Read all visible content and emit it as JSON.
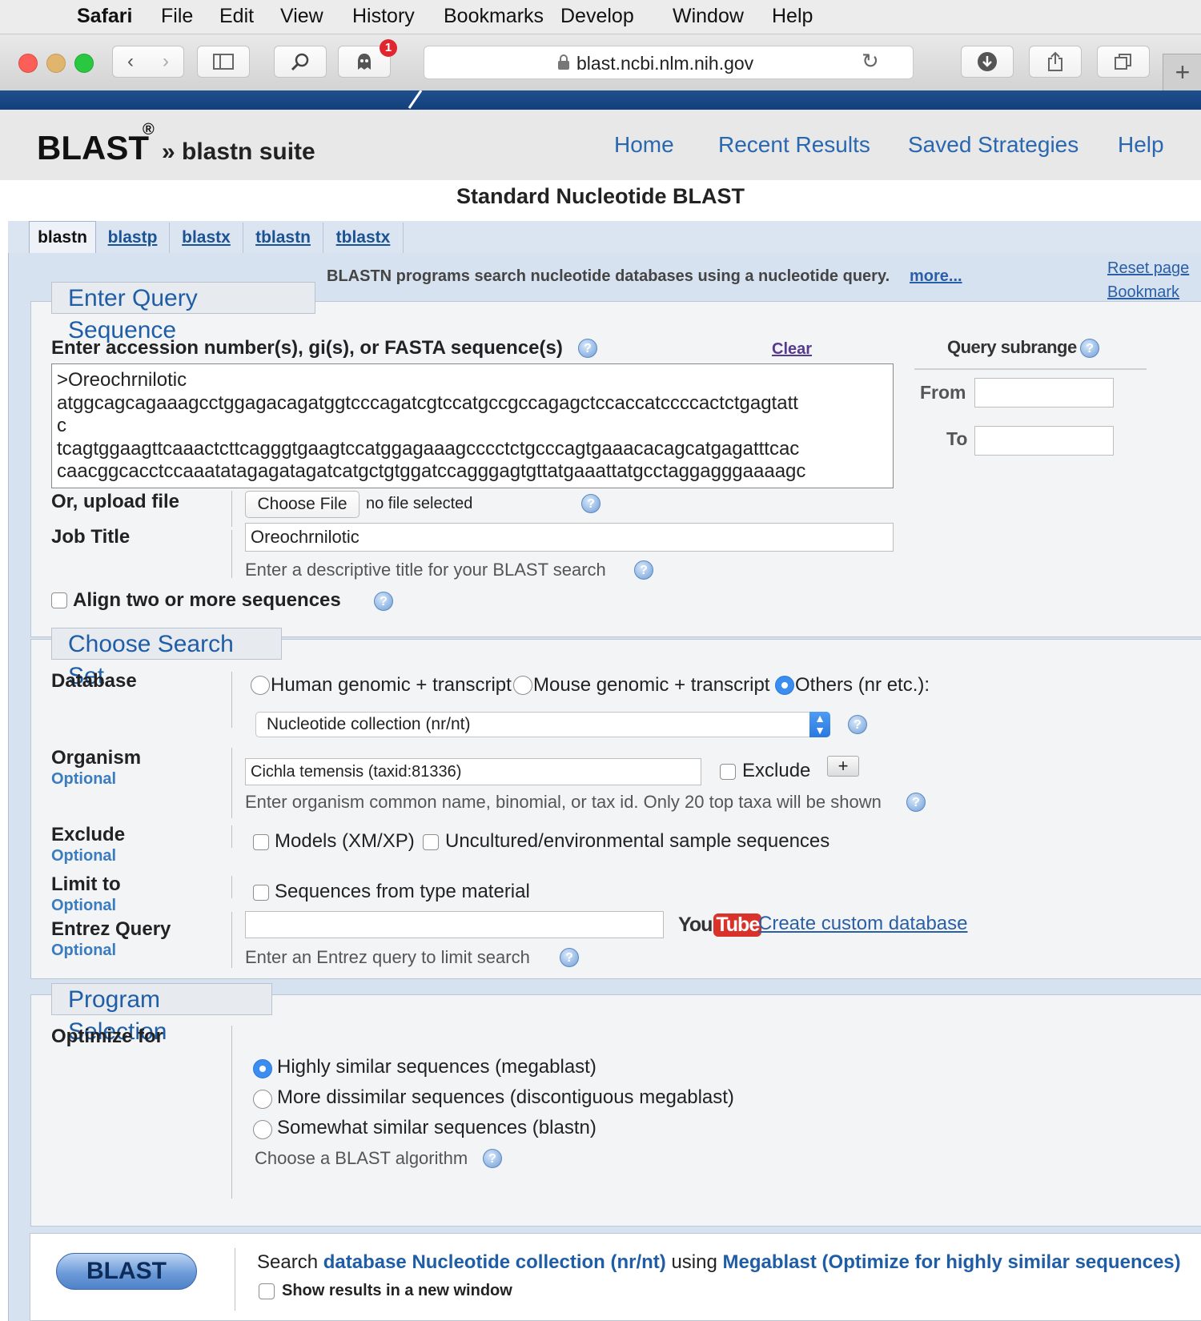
{
  "menubar": {
    "app": "Safari",
    "items": [
      "File",
      "Edit",
      "View",
      "History",
      "Bookmarks",
      "Develop",
      "Window",
      "Help"
    ]
  },
  "browser": {
    "url": "blast.ncbi.nlm.nih.gov",
    "badge": "1"
  },
  "header": {
    "logo": "BLAST",
    "reg": "®",
    "suite": "» blastn suite",
    "nav": [
      "Home",
      "Recent Results",
      "Saved Strategies",
      "Help"
    ]
  },
  "page_title": "Standard Nucleotide BLAST",
  "tabs": [
    "blastn",
    "blastp",
    "blastx",
    "tblastn",
    "tblastx"
  ],
  "info": {
    "text": "BLASTN programs search nucleotide databases using a nucleotide query.",
    "more": "more...",
    "reset": "Reset page",
    "bookmark": "Bookmark"
  },
  "query": {
    "section_title": "Enter Query Sequence",
    "label": "Enter accession number(s), gi(s), or FASTA sequence(s)",
    "clear": "Clear",
    "sequence_lines": [
      ">Oreochrnilotic",
      "atggcagcagaaagcctggagacagatggtcccagatcgtccatgccgccagagctccaccatccccactctgagtatt",
      "c",
      "tcagtggaagttcaaactcttcagggtgaagtccatggagaaagcccctctgcccagtgaaacacagcatgagatttcac",
      "caacggcacctccaaatatagagatagatcatgctgtggatccagggagtgttatgaaattatgcctaggagggaaaagc"
    ],
    "subrange_title": "Query subrange",
    "from": "From",
    "to": "To",
    "upload_label": "Or, upload file",
    "choose_file": "Choose File",
    "no_file": "no file selected",
    "job_title_label": "Job Title",
    "job_title_value": "Oreochrnilotic",
    "job_title_hint": "Enter a descriptive title for your BLAST search",
    "align_two": "Align two or more sequences"
  },
  "search_set": {
    "section_title": "Choose Search Set",
    "database_label": "Database",
    "db_options": [
      "Human genomic + transcript",
      "Mouse genomic + transcript",
      "Others (nr etc.):"
    ],
    "db_selected": "Nucleotide collection (nr/nt)",
    "organism_label": "Organism",
    "optional": "Optional",
    "organism_value": "Cichla temensis (taxid:81336)",
    "exclude_check": "Exclude",
    "plus": "+",
    "organism_hint": "Enter organism common name, binomial, or tax id. Only 20 top taxa will be shown",
    "exclude_label": "Exclude",
    "exclude_models": "Models (XM/XP)",
    "exclude_uncultured": "Uncultured/environmental sample sequences",
    "limit_label": "Limit to",
    "limit_type": "Sequences from type material",
    "entrez_label": "Entrez Query",
    "youtube_you": "You",
    "youtube_tube": "Tube",
    "custom_db": "Create custom database",
    "entrez_hint": "Enter an Entrez query to limit search"
  },
  "program": {
    "section_title": "Program Selection",
    "optimize_label": "Optimize for",
    "options": [
      "Highly similar sequences (megablast)",
      "More dissimilar sequences (discontiguous megablast)",
      "Somewhat similar sequences (blastn)"
    ],
    "hint": "Choose a BLAST algorithm"
  },
  "submit": {
    "button": "BLAST",
    "search": "Search",
    "db_phrase": "database Nucleotide collection (nr/nt)",
    "using": "using",
    "algo_phrase": "Megablast (Optimize for highly similar sequences)",
    "new_window": "Show results in a new window"
  },
  "colors": {
    "accent": "#2967b0",
    "header_blue": "#1f5ea7",
    "dark_strip": "#1f4f8d"
  }
}
